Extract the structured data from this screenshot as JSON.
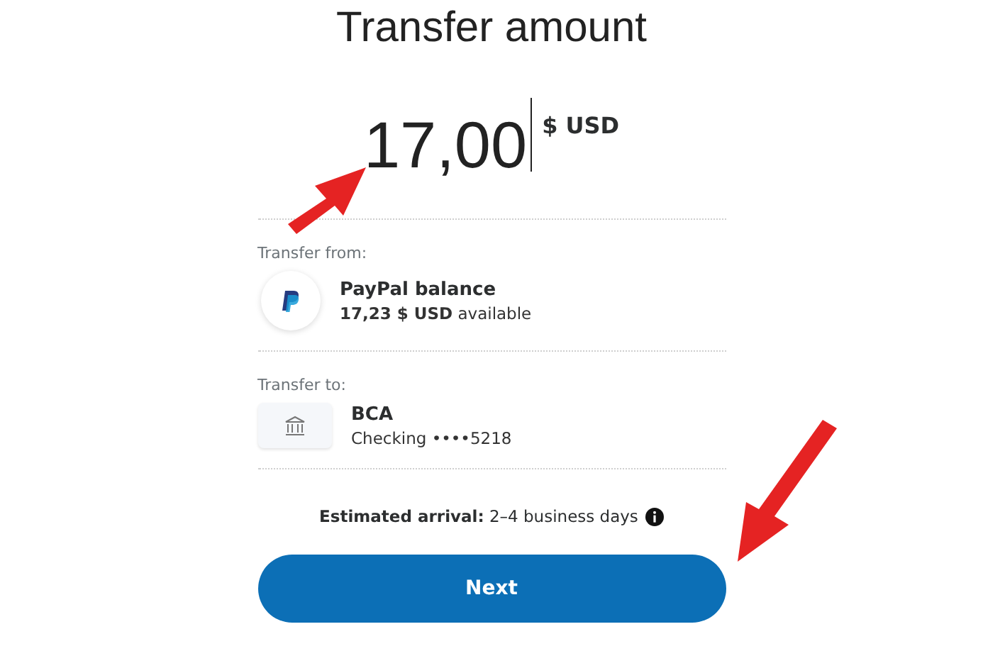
{
  "title": "Transfer amount",
  "amount": {
    "value": "17,00",
    "currency": "$ USD"
  },
  "from": {
    "label": "Transfer from:",
    "name": "PayPal balance",
    "detail": "**17,23 $ USD** available"
  },
  "to": {
    "label": "Transfer to:",
    "name": "BCA",
    "detail": "Checking ••••5218"
  },
  "arrival": "**Estimated arrival:** 2–4 business days",
  "button": "Next"
}
